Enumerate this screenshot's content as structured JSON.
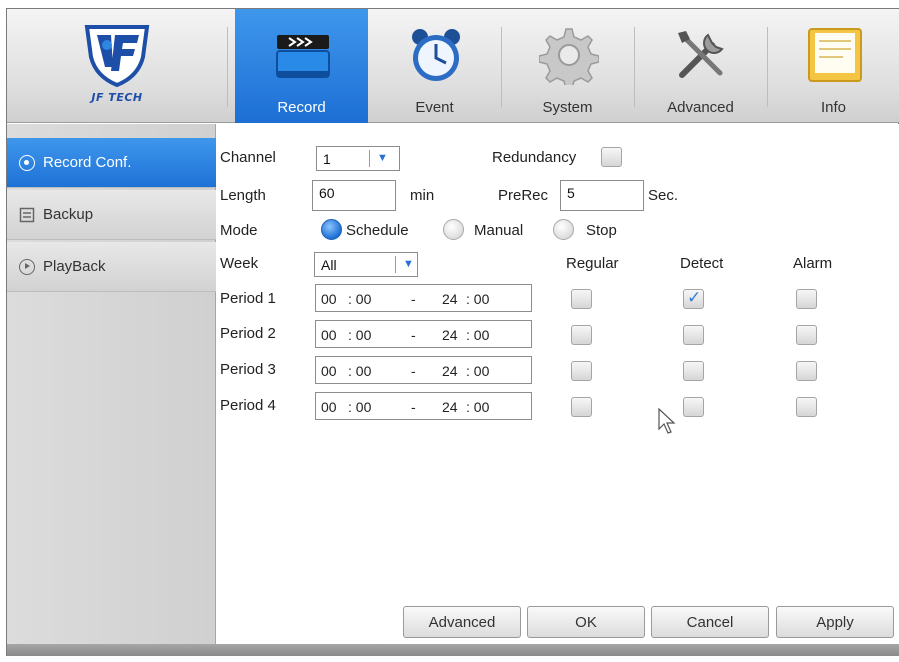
{
  "brand": {
    "name": "JF TECH"
  },
  "tabs": [
    {
      "label": "Record",
      "icon": "record-clapper-icon",
      "active": true
    },
    {
      "label": "Event",
      "icon": "alarm-clock-icon",
      "active": false
    },
    {
      "label": "System",
      "icon": "gear-icon",
      "active": false
    },
    {
      "label": "Advanced",
      "icon": "tools-icon",
      "active": false
    },
    {
      "label": "Info",
      "icon": "document-icon",
      "active": false
    }
  ],
  "sidebar": {
    "items": [
      {
        "label": "Record Conf.",
        "icon": "target-icon",
        "active": true
      },
      {
        "label": "Backup",
        "icon": "storage-icon",
        "active": false
      },
      {
        "label": "PlayBack",
        "icon": "play-icon",
        "active": false
      }
    ]
  },
  "form": {
    "channel_label": "Channel",
    "channel_value": "1",
    "redundancy_label": "Redundancy",
    "redundancy_checked": false,
    "length_label": "Length",
    "length_value": "60",
    "length_unit": "min",
    "prerec_label": "PreRec",
    "prerec_value": "5",
    "prerec_unit": "Sec.",
    "mode_label": "Mode",
    "mode_options": [
      "Schedule",
      "Manual",
      "Stop"
    ],
    "mode_selected": "Schedule",
    "week_label": "Week",
    "week_value": "All",
    "col_regular": "Regular",
    "col_detect": "Detect",
    "col_alarm": "Alarm",
    "periods": [
      {
        "label": "Period 1",
        "start_h": "00",
        "start_m": ": 00",
        "dash": "-",
        "end_h": "24",
        "end_m": ": 00",
        "regular": false,
        "detect": true,
        "alarm": false
      },
      {
        "label": "Period 2",
        "start_h": "00",
        "start_m": ": 00",
        "dash": "-",
        "end_h": "24",
        "end_m": ": 00",
        "regular": false,
        "detect": false,
        "alarm": false
      },
      {
        "label": "Period 3",
        "start_h": "00",
        "start_m": ": 00",
        "dash": "-",
        "end_h": "24",
        "end_m": ": 00",
        "regular": false,
        "detect": false,
        "alarm": false
      },
      {
        "label": "Period 4",
        "start_h": "00",
        "start_m": ": 00",
        "dash": "-",
        "end_h": "24",
        "end_m": ": 00",
        "regular": false,
        "detect": false,
        "alarm": false
      }
    ]
  },
  "buttons": {
    "advanced": "Advanced",
    "ok": "OK",
    "cancel": "Cancel",
    "apply": "Apply"
  },
  "colors": {
    "accent": "#2a7ee0",
    "accent_dark": "#1d6fd4",
    "check": "#2f7ed8"
  }
}
